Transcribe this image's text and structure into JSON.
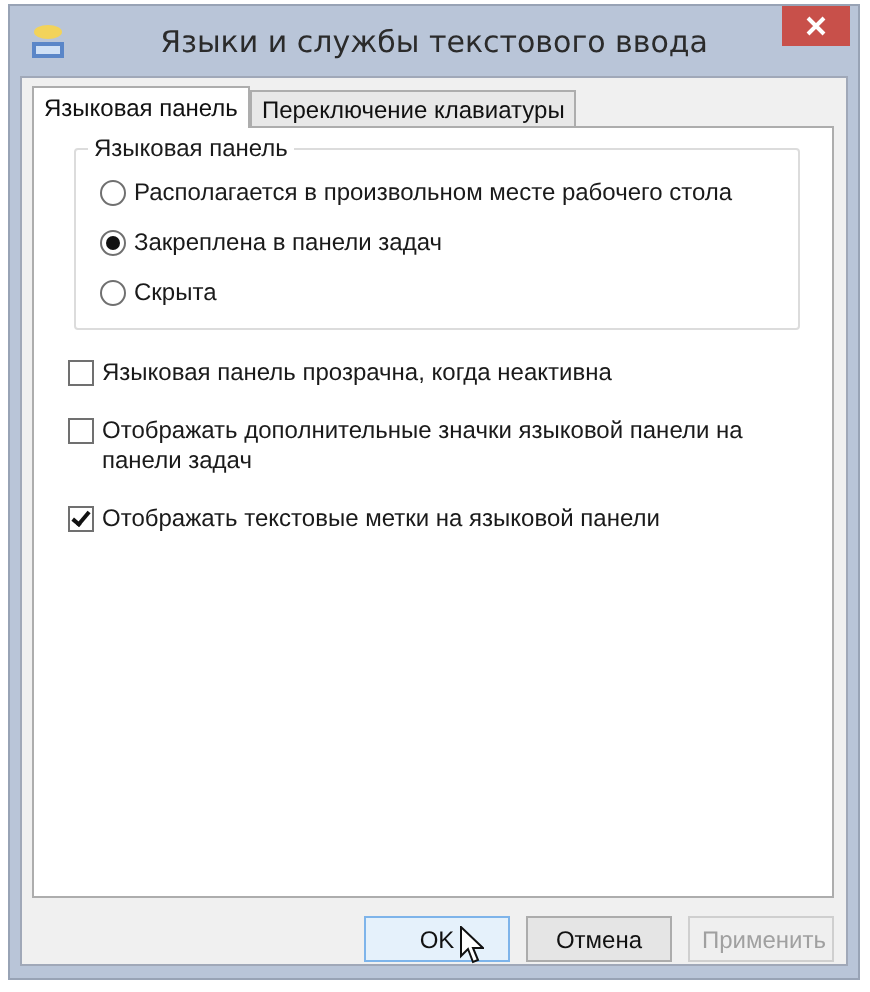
{
  "window": {
    "title": "Языки и службы текстового ввода"
  },
  "tabs": [
    {
      "label": "Языковая панель",
      "selected": true
    },
    {
      "label": "Переключение клавиатуры",
      "selected": false
    }
  ],
  "group": {
    "title": "Языковая панель",
    "options": [
      {
        "label": "Располагается в произвольном месте рабочего стола",
        "selected": false
      },
      {
        "label": "Закреплена в панели задач",
        "selected": true
      },
      {
        "label": "Скрыта",
        "selected": false
      }
    ]
  },
  "checkboxes": [
    {
      "label": "Языковая панель прозрачна, когда неактивна",
      "checked": false
    },
    {
      "label": "Отображать дополнительные значки языковой панели на панели задач",
      "checked": false
    },
    {
      "label": "Отображать текстовые метки на языковой панели",
      "checked": true
    }
  ],
  "buttons": [
    {
      "label": "OK",
      "hovered": true,
      "disabled": false
    },
    {
      "label": "Отмена",
      "hovered": false,
      "disabled": false
    },
    {
      "label": "Применить",
      "hovered": false,
      "disabled": true
    }
  ]
}
